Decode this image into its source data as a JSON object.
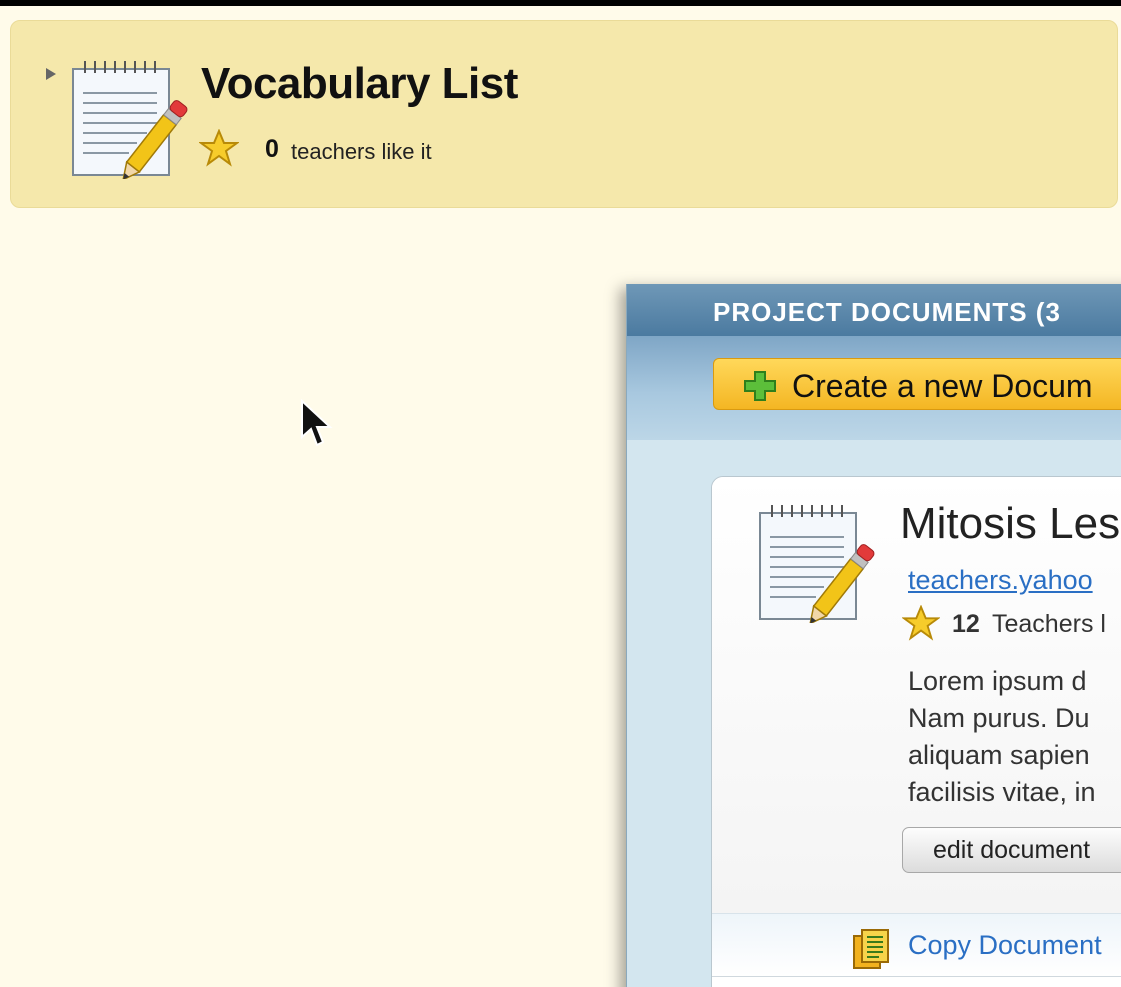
{
  "header": {
    "title": "Vocabulary List",
    "likes_count": "0",
    "likes_text": "teachers like it"
  },
  "icons": {
    "expand": "triangle-right-icon",
    "document": "document-pencil-icon",
    "star": "star-icon",
    "plus": "green-plus-icon",
    "copy": "copy-document-icon",
    "cursor": "mouse-pointer-icon"
  },
  "panel": {
    "header_label": "PROJECT DOCUMENTS (3",
    "create_button_label": "Create a new Docum",
    "document": {
      "title": "Mitosis Les",
      "link": "teachers.yahoo",
      "likes_count": "12",
      "likes_text": "Teachers l",
      "description_lines": [
        "Lorem ipsum d",
        "Nam purus. Du",
        "aliquam sapien",
        "facilisis vitae, in"
      ],
      "edit_button_label": "edit document",
      "copy_link": "Copy Document"
    }
  },
  "colors": {
    "page_background": "#fffbea",
    "header_card": "#f5e8ab",
    "panel_header": "#5a87aa",
    "create_button": "#f7c232",
    "link": "#2a6fc4"
  }
}
